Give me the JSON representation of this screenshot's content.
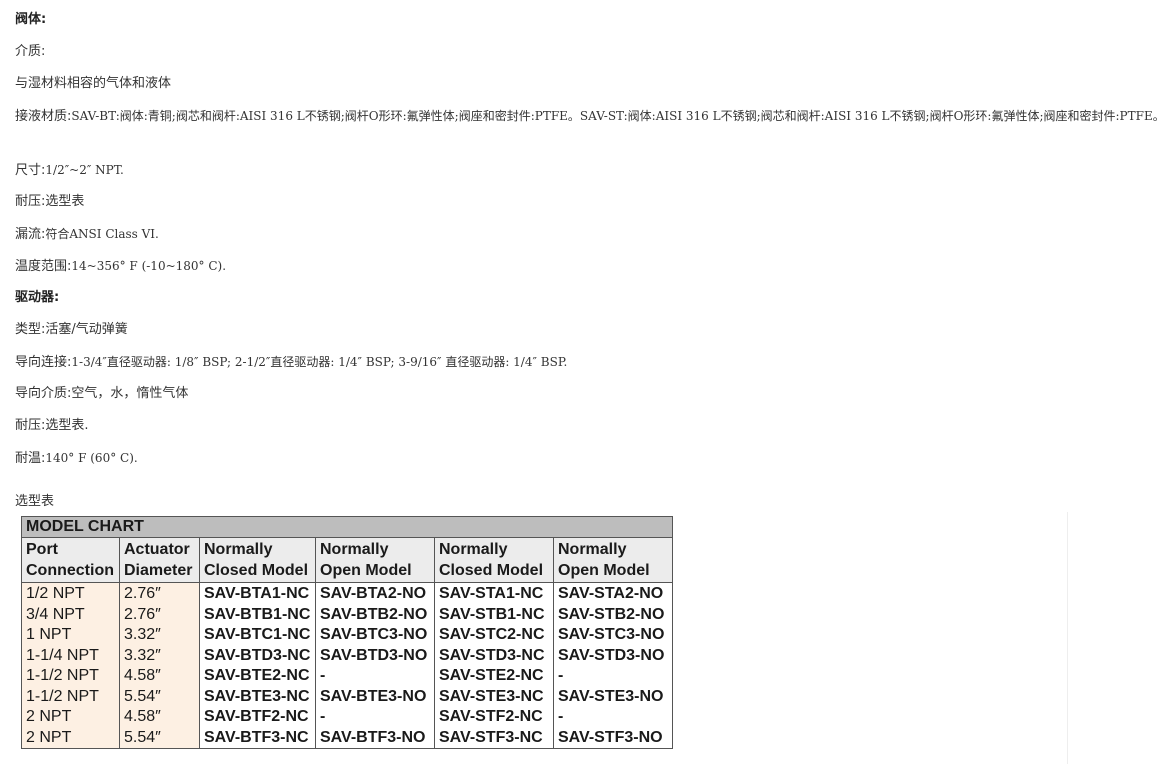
{
  "body_section": {
    "title": "阀体:",
    "media_label": "介质:",
    "media_value": "与湿材料相容的气体和液体",
    "wetted_label": "接液材质:",
    "wetted_value": "SAV-BT:阀体:青铜;阀芯和阀杆:AISI 316 L不锈钢;阀杆O形环:氟弹性体;阀座和密封件:PTFE。SAV-ST:阀体:AISI 316 L不锈钢;阀芯和阀杆:AISI 316 L不锈钢;阀杆O形环:氟弹性体;阀座和密封件:PTFE。",
    "size_label": "尺寸:",
    "size_value": "1/2″~2″ NPT.",
    "pressure_label": "耐压:",
    "pressure_value": "选型表",
    "leakage_label": "漏流:",
    "leakage_value": "符合ANSI Class VI.",
    "temp_label": "温度范围:",
    "temp_value": "14~356° F (-10~180° C)."
  },
  "actuator_section": {
    "title": "驱动器:",
    "type_label": "类型:",
    "type_value": "活塞/气动弹簧",
    "pilot_conn_label": "导向连接:",
    "pilot_conn_value": "1-3/4″直径驱动器: 1/8″ BSP; 2-1/2″直径驱动器: 1/4″ BSP; 3-9/16″ 直径驱动器: 1/4″ BSP.",
    "pilot_media_label": "导向介质:",
    "pilot_media_value": "空气，水，惰性气体",
    "pressure_label": "耐压:",
    "pressure_value": "选型表.",
    "temp_label": "耐温:",
    "temp_value": "140° F (60° C)."
  },
  "chart_caption": "选型表",
  "model_chart": {
    "title": "MODEL CHART",
    "headers": [
      [
        "Port",
        "Connection"
      ],
      [
        "Actuator",
        "Diameter"
      ],
      [
        "Normally",
        "Closed Model"
      ],
      [
        "Normally",
        "Open Model"
      ],
      [
        "Normally",
        "Closed Model"
      ],
      [
        "Normally",
        "Open Model"
      ]
    ],
    "rows": [
      [
        "1/2 NPT",
        "2.76″",
        "SAV-BTA1-NC",
        "SAV-BTA2-NO",
        "SAV-STA1-NC",
        "SAV-STA2-NO"
      ],
      [
        "3/4 NPT",
        "2.76″",
        "SAV-BTB1-NC",
        "SAV-BTB2-NO",
        "SAV-STB1-NC",
        "SAV-STB2-NO"
      ],
      [
        "1 NPT",
        "3.32″",
        "SAV-BTC1-NC",
        "SAV-BTC3-NO",
        "SAV-STC2-NC",
        "SAV-STC3-NO"
      ],
      [
        "1-1/4 NPT",
        "3.32″",
        "SAV-BTD3-NC",
        "SAV-BTD3-NO",
        "SAV-STD3-NC",
        "SAV-STD3-NO"
      ],
      [
        "1-1/2 NPT",
        "4.58″",
        "SAV-BTE2-NC",
        "-",
        "SAV-STE2-NC",
        "-"
      ],
      [
        "1-1/2 NPT",
        "5.54″",
        "SAV-BTE3-NC",
        "SAV-BTE3-NO",
        "SAV-STE3-NC",
        "SAV-STE3-NO"
      ],
      [
        "2 NPT",
        "4.58″",
        "SAV-BTF2-NC",
        "-",
        "SAV-STF2-NC",
        "-"
      ],
      [
        "2 NPT",
        "5.54″",
        "SAV-BTF3-NC",
        "SAV-BTF3-NO",
        "SAV-STF3-NC",
        "SAV-STF3-NO"
      ]
    ]
  }
}
